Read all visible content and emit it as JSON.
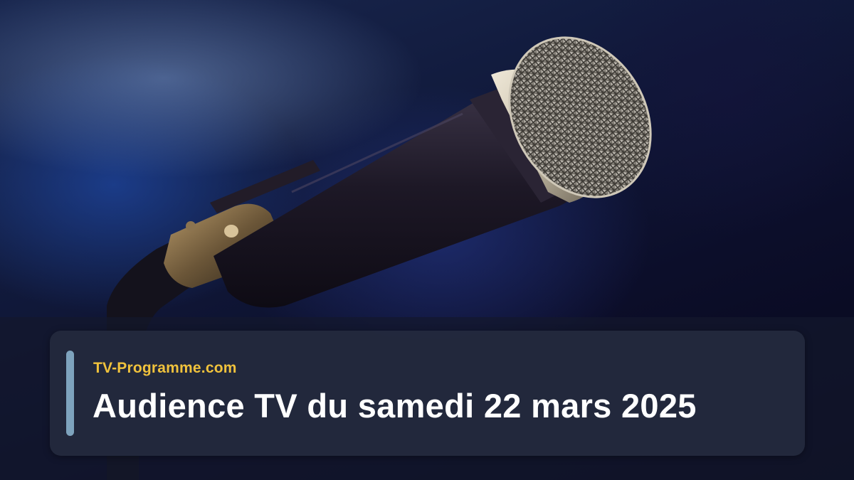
{
  "brand": {
    "site_name": "TV-Programme.com",
    "color": "#f0c23c"
  },
  "article": {
    "title": "Audience TV du samedi 22 mars 2025"
  },
  "theme": {
    "accent_bar_color": "#7ea3bd",
    "card_background": "#242a3e",
    "title_color": "#ffffff"
  },
  "hero_image": {
    "subject_icon": "microphone-icon"
  }
}
